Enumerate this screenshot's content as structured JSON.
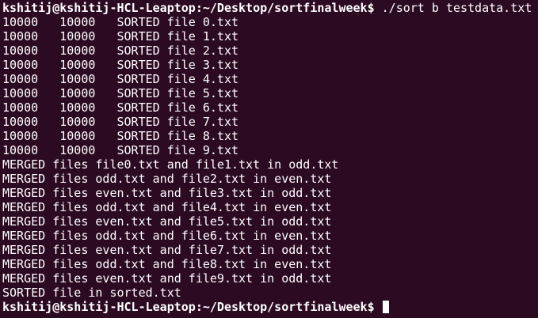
{
  "terminal": {
    "lines": [
      {
        "kind": "prompt",
        "prompt": "kshitij@kshitij-HCL-Leaptop:~/Desktop/sortfinalweek$",
        "command": " ./sort b testdata.txt"
      },
      {
        "kind": "output",
        "text": "10000   10000   SORTED file 0.txt"
      },
      {
        "kind": "output",
        "text": "10000   10000   SORTED file 1.txt"
      },
      {
        "kind": "output",
        "text": "10000   10000   SORTED file 2.txt"
      },
      {
        "kind": "output",
        "text": "10000   10000   SORTED file 3.txt"
      },
      {
        "kind": "output",
        "text": "10000   10000   SORTED file 4.txt"
      },
      {
        "kind": "output",
        "text": "10000   10000   SORTED file 5.txt"
      },
      {
        "kind": "output",
        "text": "10000   10000   SORTED file 6.txt"
      },
      {
        "kind": "output",
        "text": "10000   10000   SORTED file 7.txt"
      },
      {
        "kind": "output",
        "text": "10000   10000   SORTED file 8.txt"
      },
      {
        "kind": "output",
        "text": "10000   10000   SORTED file 9.txt"
      },
      {
        "kind": "output",
        "text": "MERGED files file0.txt and file1.txt in odd.txt"
      },
      {
        "kind": "output",
        "text": "MERGED files odd.txt and file2.txt in even.txt"
      },
      {
        "kind": "output",
        "text": "MERGED files even.txt and file3.txt in odd.txt"
      },
      {
        "kind": "output",
        "text": "MERGED files odd.txt and file4.txt in even.txt"
      },
      {
        "kind": "output",
        "text": "MERGED files even.txt and file5.txt in odd.txt"
      },
      {
        "kind": "output",
        "text": "MERGED files odd.txt and file6.txt in even.txt"
      },
      {
        "kind": "output",
        "text": "MERGED files even.txt and file7.txt in odd.txt"
      },
      {
        "kind": "output",
        "text": "MERGED files odd.txt and file8.txt in even.txt"
      },
      {
        "kind": "output",
        "text": "MERGED files even.txt and file9.txt in odd.txt"
      },
      {
        "kind": "output",
        "text": "SORTED file in sorted.txt"
      },
      {
        "kind": "prompt",
        "prompt": "kshitij@kshitij-HCL-Leaptop:~/Desktop/sortfinalweek$",
        "command": " ",
        "cursor": true
      }
    ]
  },
  "colors": {
    "background": "#2c0a22",
    "foreground": "#ffffff"
  }
}
